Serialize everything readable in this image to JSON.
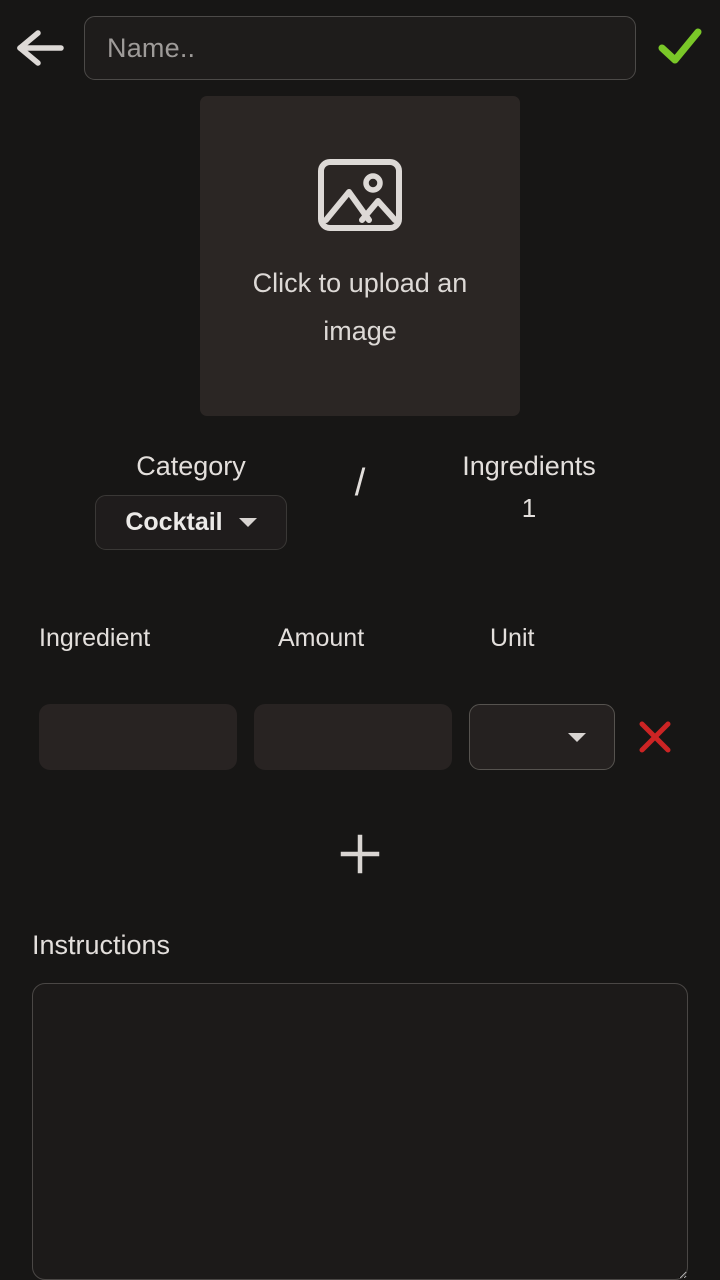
{
  "theme": {
    "background": "#171615",
    "surface": "#2b2624",
    "input_fill": "#282322",
    "text": "#e3dfdc",
    "placeholder": "#9e9b99",
    "accent_confirm": "#7ac728",
    "accent_delete": "#cc2424",
    "border": "#4c4a48"
  },
  "topbar": {
    "back_icon": "arrow-left-icon",
    "name_input": {
      "value": "",
      "placeholder": "Name.."
    },
    "confirm_icon": "check-icon"
  },
  "image_upload": {
    "icon": "image-placeholder-icon",
    "label": "Click to upload an image"
  },
  "meta": {
    "category": {
      "label": "Category",
      "selected": "Cocktail",
      "caret_icon": "chevron-down-icon"
    },
    "separator": "/",
    "ingredients": {
      "label": "Ingredients",
      "count": "1"
    }
  },
  "ingredient_table": {
    "headers": [
      "Ingredient",
      "Amount",
      "Unit"
    ],
    "rows": [
      {
        "ingredient": "",
        "amount": "",
        "unit": "",
        "unit_caret_icon": "chevron-down-icon",
        "remove_icon": "close-x-icon"
      }
    ],
    "add_icon": "plus-icon"
  },
  "instructions": {
    "label": "Instructions",
    "value": "",
    "placeholder": ""
  }
}
